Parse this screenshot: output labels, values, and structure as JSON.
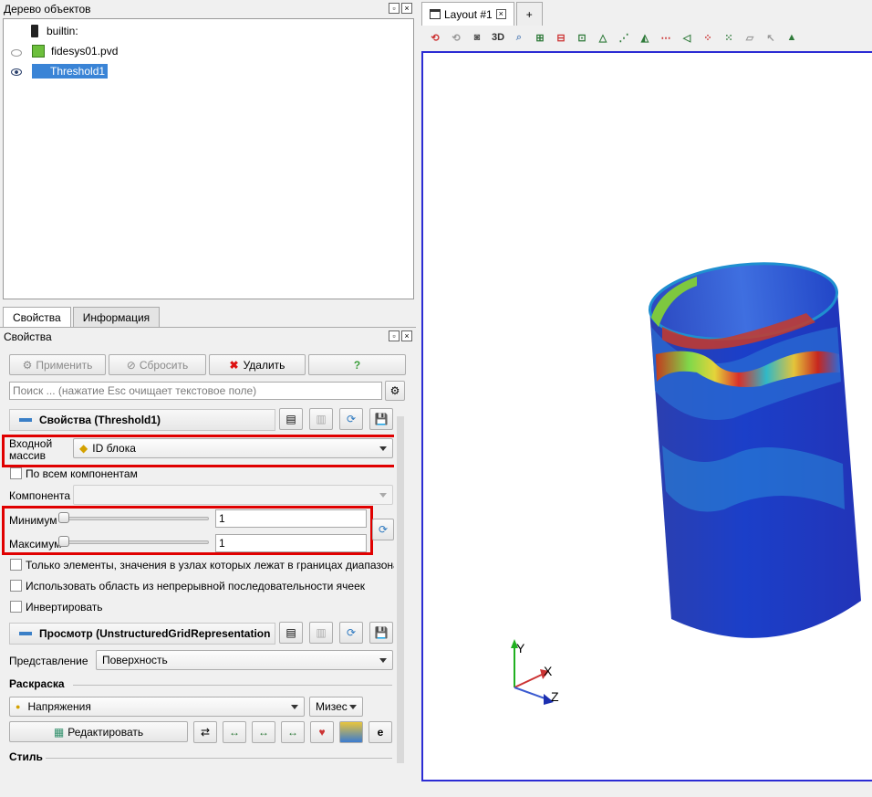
{
  "pipeline": {
    "title": "Дерево объектов",
    "items": [
      {
        "label": "builtin:"
      },
      {
        "label": "fidesys01.pvd"
      },
      {
        "label": "Threshold1"
      }
    ]
  },
  "tabs": {
    "properties": "Свойства",
    "information": "Информация"
  },
  "properties": {
    "panel_title": "Свойства",
    "buttons": {
      "apply": "Применить",
      "reset": "Сбросить",
      "delete": "Удалить",
      "help": "?"
    },
    "search_placeholder": "Поиск ... (нажатие Esc очищает текстовое поле)",
    "section_properties": "Свойства (Threshold1)",
    "input_array_label": "Входной массив",
    "input_array_value": "ID блока",
    "all_components": "По всем компонентам",
    "component_label": "Компонента",
    "minimum_label": "Минимум",
    "minimum_value": "1",
    "maximum_label": "Максимум",
    "maximum_value": "1",
    "option_only_elements": "Только элементы, значения в узлах которых лежат в границах диапазона",
    "option_continuous": "Использовать область из непрерывной последовательности ячеек",
    "option_invert": "Инвертировать",
    "section_display": "Просмотр (UnstructuredGridRepresentation",
    "representation_label": "Представление",
    "representation_value": "Поверхность",
    "coloring_label": "Раскраска",
    "coloring_array": "Напряжения",
    "coloring_component": "Мизес",
    "edit_button": "Редактировать",
    "style_label": "Стиль"
  },
  "layout": {
    "tab_label": "Layout #1",
    "plus_label": "+",
    "toolbar_3d": "3D"
  },
  "axes": {
    "x": "X",
    "y": "Y",
    "z": "Z"
  },
  "colors": {
    "selection": "#3a84d6",
    "highlight_box": "#e00000",
    "view_border": "#2c2cd4"
  }
}
